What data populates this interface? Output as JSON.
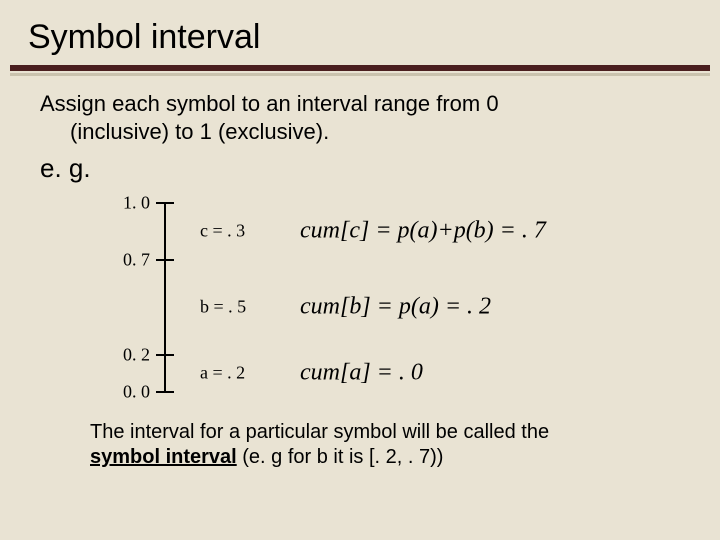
{
  "title": "Symbol interval",
  "lead_line1": "Assign each symbol to an interval range from 0",
  "lead_line2": "(inclusive) to 1 (exclusive).",
  "eg": "e. g.",
  "ticks": {
    "t1_0": "1. 0",
    "t0_7": "0. 7",
    "t0_2": "0. 2",
    "t0_0": "0. 0"
  },
  "segments": {
    "c": "c = . 3",
    "b": "b = . 5",
    "a": "a = . 2"
  },
  "cum": {
    "c": "cum[c] = p(a)+p(b) = . 7",
    "b": "cum[b] = p(a) = . 2",
    "a": "cum[a] = . 0"
  },
  "foot_pre": "The interval for a particular symbol will be called the ",
  "foot_term": "symbol interval",
  "foot_post": " (e. g for b it is [. 2, . 7))",
  "chart_data": {
    "type": "table",
    "title": "Symbol intervals on [0,1)",
    "axis_range": [
      0.0,
      1.0
    ],
    "tick_values": [
      0.0,
      0.2,
      0.7,
      1.0
    ],
    "symbols": [
      {
        "symbol": "a",
        "p": 0.2,
        "cum": 0.0,
        "interval": [
          0.0,
          0.2
        ]
      },
      {
        "symbol": "b",
        "p": 0.5,
        "cum": 0.2,
        "interval": [
          0.2,
          0.7
        ]
      },
      {
        "symbol": "c",
        "p": 0.3,
        "cum": 0.7,
        "interval": [
          0.7,
          1.0
        ]
      }
    ]
  }
}
